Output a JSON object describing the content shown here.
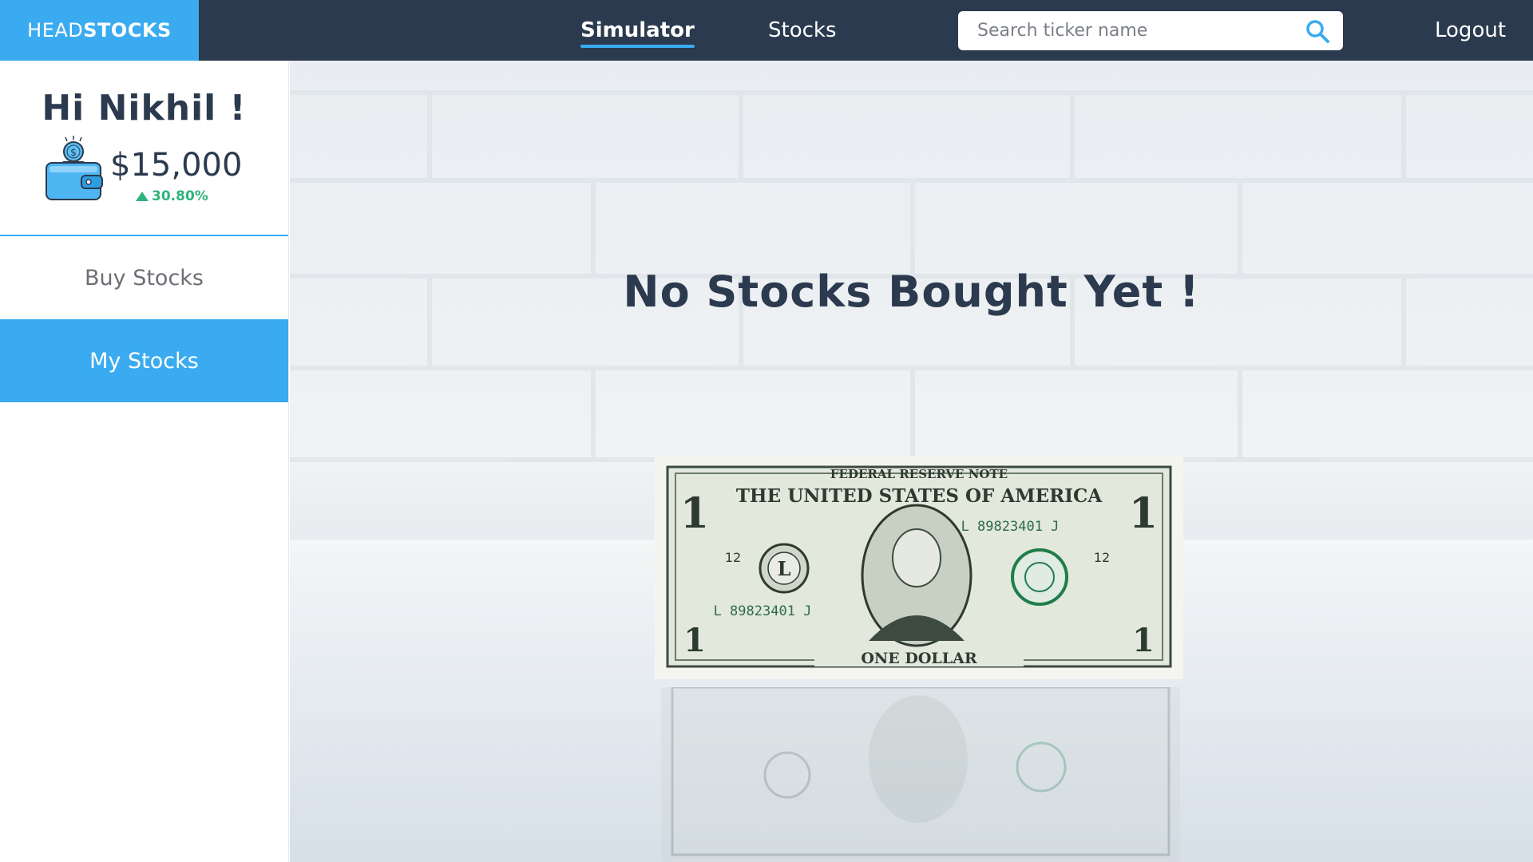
{
  "navbar": {
    "brand_light": "HEAD",
    "brand_bold": "STOCKS",
    "links": [
      {
        "label": "Simulator",
        "active": true
      },
      {
        "label": "Stocks",
        "active": false
      }
    ],
    "search_placeholder": "Search ticker name",
    "logout_label": "Logout",
    "colors": {
      "bar": "#2b3a4e",
      "accent": "#3aabf0"
    }
  },
  "sidebar": {
    "greeting": "Hi Nikhil !",
    "balance": "$15,000",
    "change": "30.80%",
    "change_direction": "up",
    "items": [
      {
        "label": "Buy Stocks",
        "active": false
      },
      {
        "label": "My Stocks",
        "active": true
      }
    ],
    "colors": {
      "positive": "#2fb37a"
    }
  },
  "main": {
    "empty_message": "No Stocks Bought Yet !",
    "bill": {
      "top_banner": "FEDERAL RESERVE NOTE",
      "country": "THE UNITED STATES OF AMERICA",
      "serial": "L 89823401 J",
      "denomination": "ONE DOLLAR",
      "numeral": "1",
      "district": "L",
      "district_number": "12"
    }
  }
}
